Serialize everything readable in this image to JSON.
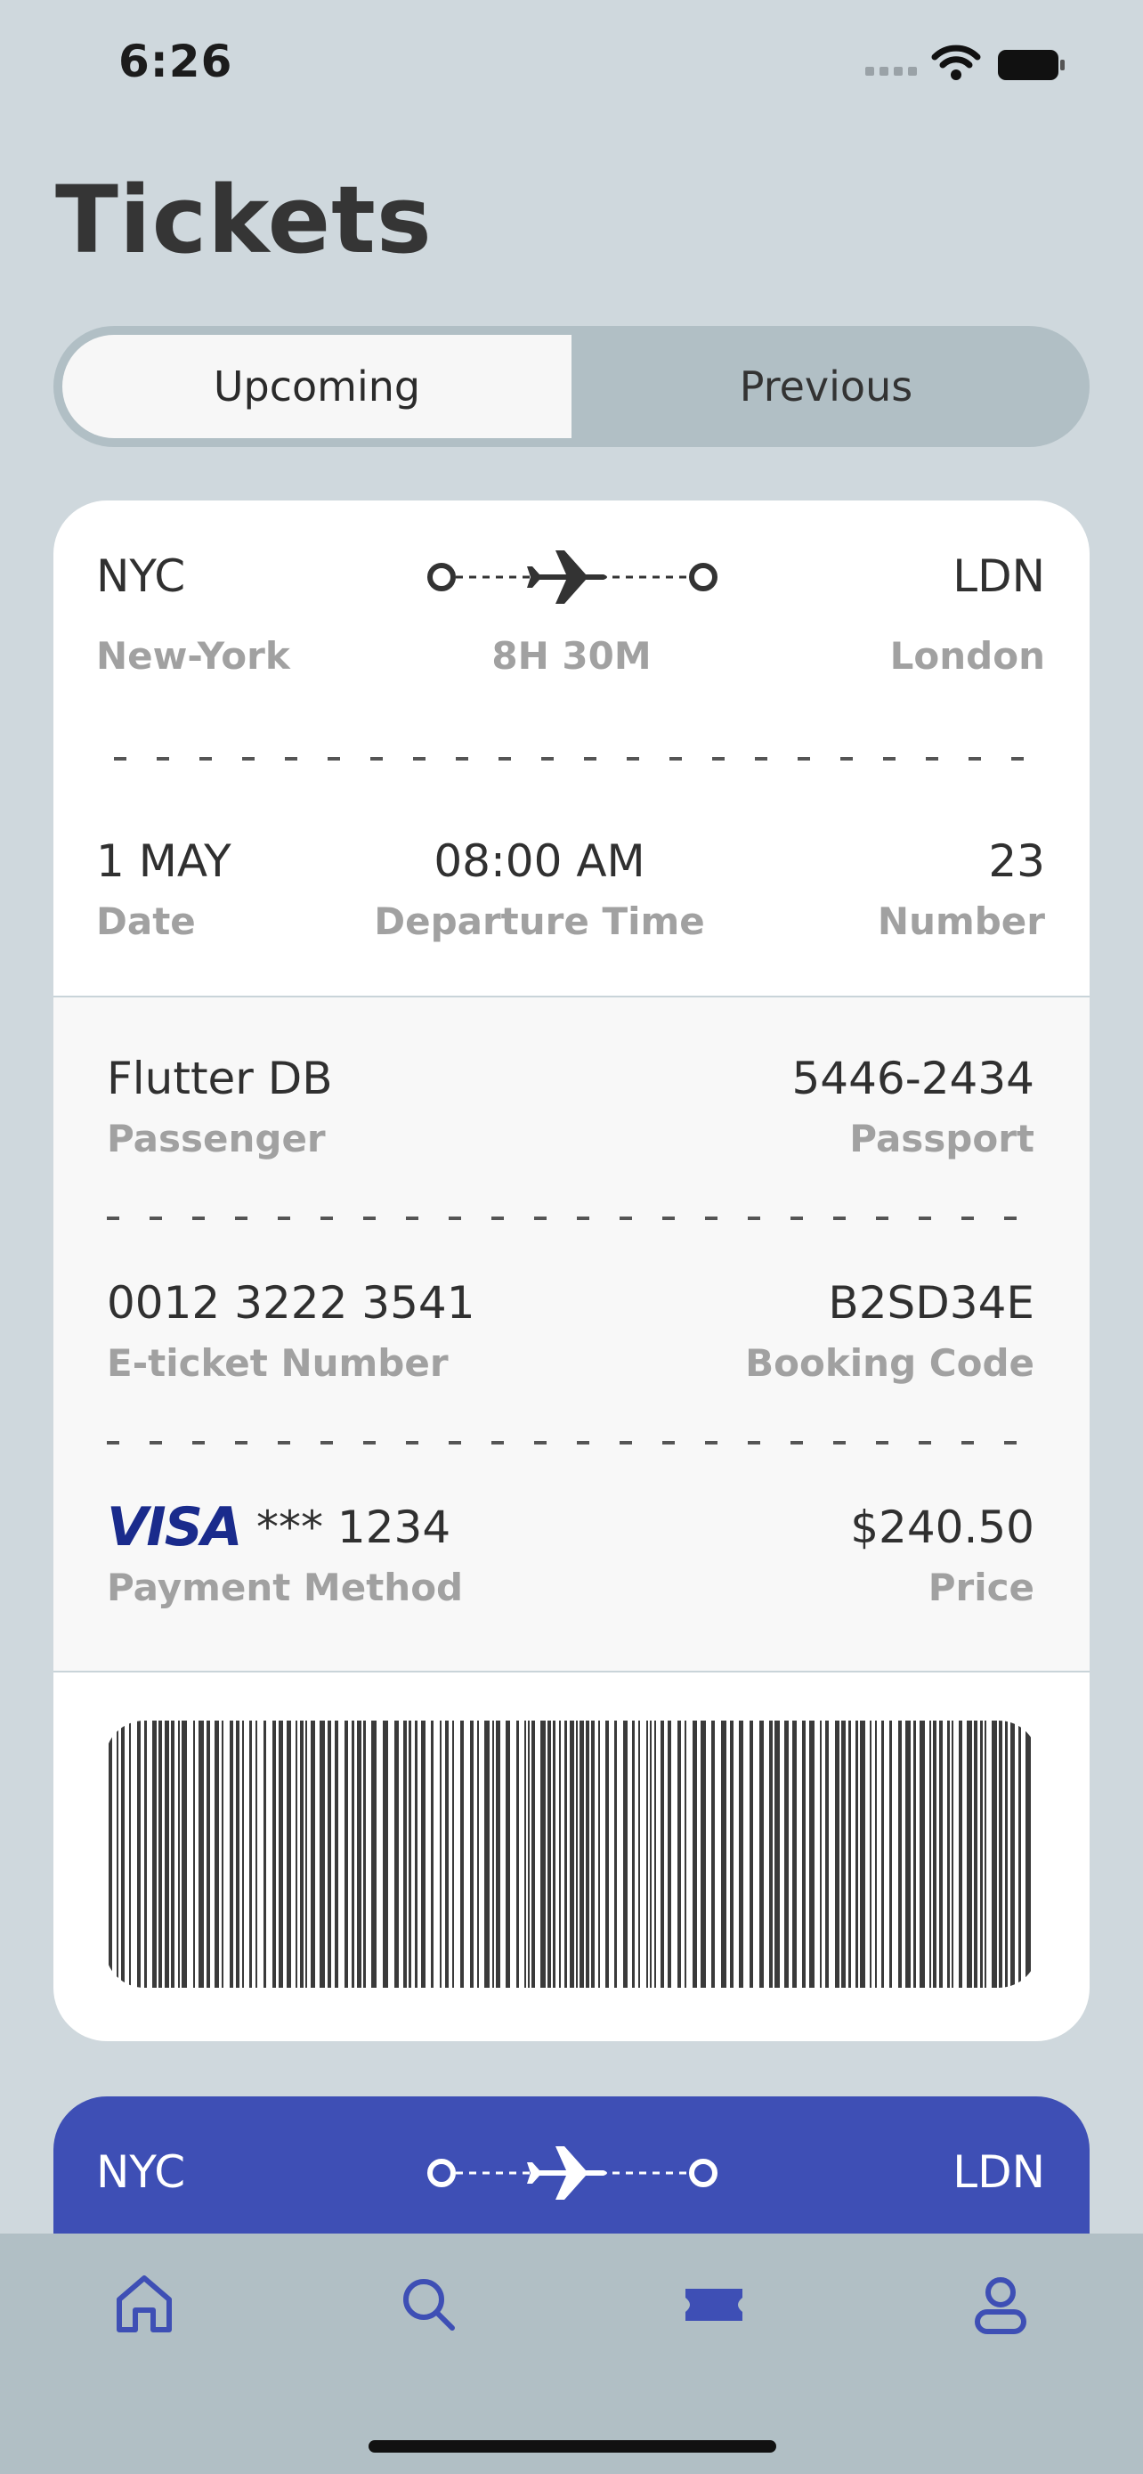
{
  "status_bar": {
    "time": "6:26"
  },
  "page": {
    "title": "Tickets"
  },
  "segments": {
    "upcoming": "Upcoming",
    "previous": "Previous"
  },
  "ticket": {
    "from_code": "NYC",
    "from_city": "New-York",
    "to_code": "LDN",
    "to_city": "London",
    "duration": "8H 30M",
    "date": "1 MAY",
    "date_label": "Date",
    "departure_time": "08:00 AM",
    "departure_label": "Departure Time",
    "number": "23",
    "number_label": "Number",
    "passenger": "Flutter DB",
    "passenger_label": "Passenger",
    "passport": "5446-2434",
    "passport_label": "Passport",
    "eticket": "0012 3222 3541",
    "eticket_label": "E-ticket Number",
    "booking_code": "B2SD34E",
    "booking_label": "Booking Code",
    "payment_brand": "VISA",
    "payment_masked": "*** 1234",
    "payment_label": "Payment Method",
    "price": "$240.50",
    "price_label": "Price"
  },
  "ticket2": {
    "from_code": "NYC",
    "to_code": "LDN"
  },
  "bottom_nav": [
    "home-icon",
    "search-icon",
    "ticket-icon",
    "profile-icon"
  ],
  "colors": {
    "background": "#cfd8dd",
    "accent": "#3e4fb5",
    "nav_bg": "#b1bfc5"
  }
}
